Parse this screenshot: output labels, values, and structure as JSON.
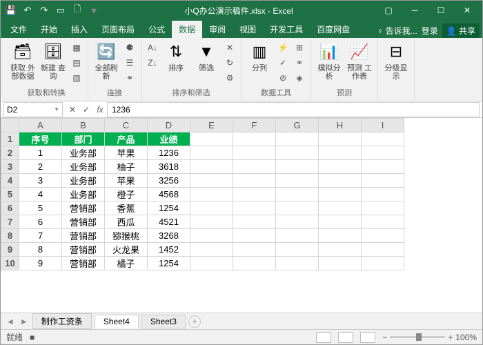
{
  "titlebar": {
    "filename": "小Q办公演示稿件.xlsx - Excel"
  },
  "tabs": {
    "file": "文件",
    "home": "开始",
    "insert": "插入",
    "layout": "页面布局",
    "formula": "公式",
    "data": "数据",
    "review": "审阅",
    "view": "视图",
    "dev": "开发工具",
    "baidu": "百度网盘",
    "tell": "告诉我...",
    "login": "登录",
    "share": "共享"
  },
  "ribbon": {
    "g1": {
      "btn1": "获取\n外部数据",
      "label": "获取和转换"
    },
    "g1b": {
      "btn": "新建\n查询"
    },
    "g2": {
      "btn": "全部刷新",
      "label": "连接"
    },
    "g3": {
      "sort": "排序",
      "filter": "筛选",
      "label": "排序和筛选"
    },
    "g4": {
      "split": "分列",
      "label": "数据工具"
    },
    "g5": {
      "sim": "模拟分析",
      "fore": "预测\n工作表",
      "label": "预测"
    },
    "g6": {
      "btn": "分级显示",
      "label": ""
    }
  },
  "namebox": "D2",
  "formula": "1236",
  "cols": [
    "A",
    "B",
    "C",
    "D",
    "E",
    "F",
    "G",
    "H",
    "I"
  ],
  "headers": [
    "序号",
    "部门",
    "产品",
    "业绩"
  ],
  "rows": [
    [
      "1",
      "业务部",
      "苹果",
      "1236"
    ],
    [
      "2",
      "业务部",
      "柚子",
      "3618"
    ],
    [
      "3",
      "业务部",
      "苹果",
      "3256"
    ],
    [
      "4",
      "业务部",
      "橙子",
      "4568"
    ],
    [
      "5",
      "营销部",
      "香蕉",
      "1254"
    ],
    [
      "6",
      "营销部",
      "西瓜",
      "4521"
    ],
    [
      "7",
      "营销部",
      "猕猴桃",
      "3268"
    ],
    [
      "8",
      "营销部",
      "火龙果",
      "1452"
    ],
    [
      "9",
      "营销部",
      "橘子",
      "1254"
    ]
  ],
  "sheets": {
    "s1": "制作工资条",
    "s2": "Sheet4",
    "s3": "Sheet3"
  },
  "status": {
    "ready": "就绪",
    "zoom": "100%"
  }
}
